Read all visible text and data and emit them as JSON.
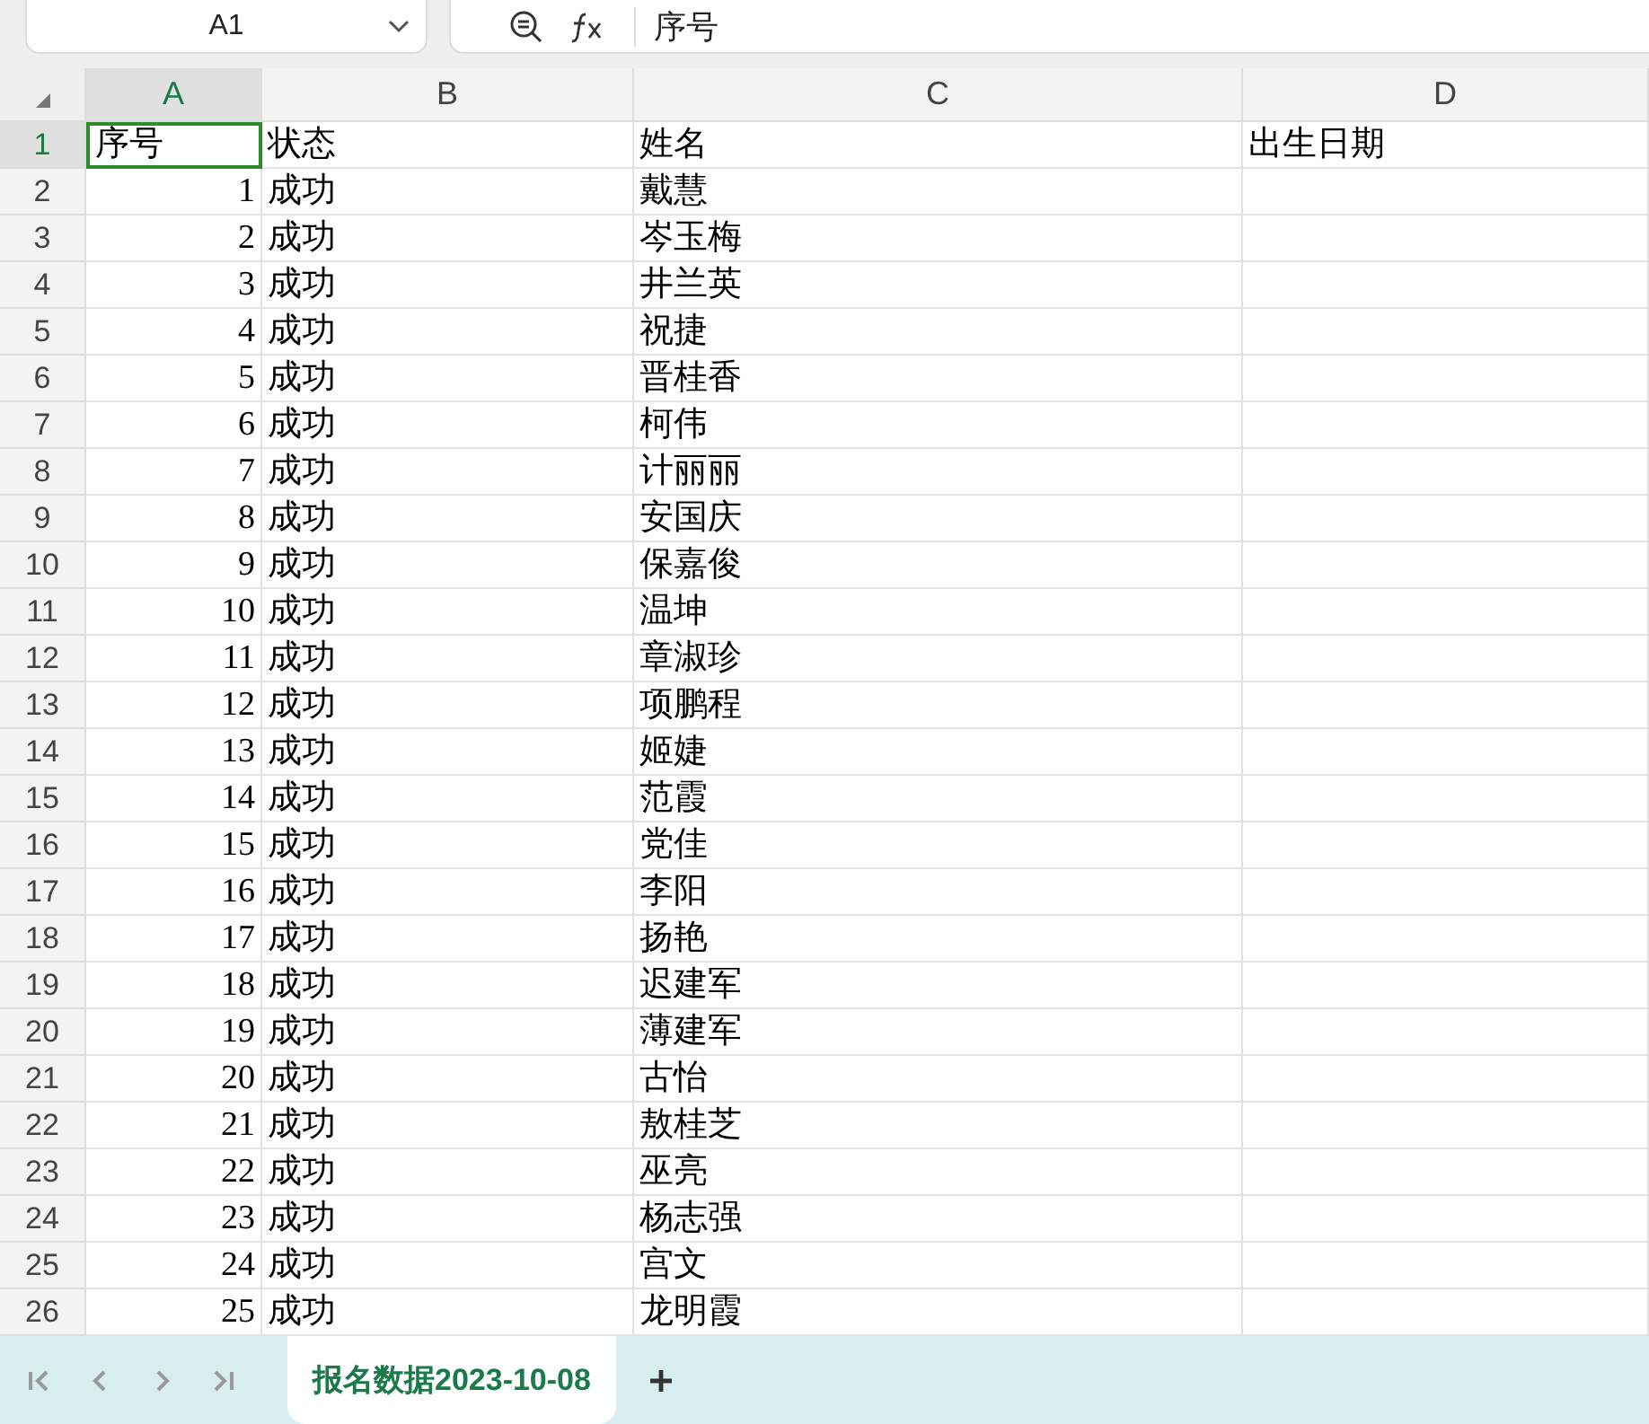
{
  "name_box": {
    "value": "A1"
  },
  "formula_bar": {
    "value": "序号"
  },
  "columns": [
    {
      "label": "A",
      "selected": true
    },
    {
      "label": "B",
      "selected": false
    },
    {
      "label": "C",
      "selected": false
    },
    {
      "label": "D",
      "selected": false
    }
  ],
  "rows": [
    {
      "number": "1",
      "selected": true,
      "cells": [
        {
          "text": "序号",
          "kind": "text"
        },
        {
          "text": "状态",
          "kind": "text"
        },
        {
          "text": "姓名",
          "kind": "text"
        },
        {
          "text": "出生日期",
          "kind": "text"
        }
      ]
    },
    {
      "number": "2",
      "selected": false,
      "cells": [
        {
          "text": "1",
          "kind": "number"
        },
        {
          "text": "成功",
          "kind": "text"
        },
        {
          "text": "戴慧",
          "kind": "text"
        }
      ]
    },
    {
      "number": "3",
      "selected": false,
      "cells": [
        {
          "text": "2",
          "kind": "number"
        },
        {
          "text": "成功",
          "kind": "text"
        },
        {
          "text": "岑玉梅",
          "kind": "text"
        }
      ]
    },
    {
      "number": "4",
      "selected": false,
      "cells": [
        {
          "text": "3",
          "kind": "number"
        },
        {
          "text": "成功",
          "kind": "text"
        },
        {
          "text": "井兰英",
          "kind": "text"
        }
      ]
    },
    {
      "number": "5",
      "selected": false,
      "cells": [
        {
          "text": "4",
          "kind": "number"
        },
        {
          "text": "成功",
          "kind": "text"
        },
        {
          "text": "祝捷",
          "kind": "text"
        }
      ]
    },
    {
      "number": "6",
      "selected": false,
      "cells": [
        {
          "text": "5",
          "kind": "number"
        },
        {
          "text": "成功",
          "kind": "text"
        },
        {
          "text": "晋桂香",
          "kind": "text"
        }
      ]
    },
    {
      "number": "7",
      "selected": false,
      "cells": [
        {
          "text": "6",
          "kind": "number"
        },
        {
          "text": "成功",
          "kind": "text"
        },
        {
          "text": "柯伟",
          "kind": "text"
        }
      ]
    },
    {
      "number": "8",
      "selected": false,
      "cells": [
        {
          "text": "7",
          "kind": "number"
        },
        {
          "text": "成功",
          "kind": "text"
        },
        {
          "text": "计丽丽",
          "kind": "text"
        }
      ]
    },
    {
      "number": "9",
      "selected": false,
      "cells": [
        {
          "text": "8",
          "kind": "number"
        },
        {
          "text": "成功",
          "kind": "text"
        },
        {
          "text": "安国庆",
          "kind": "text"
        }
      ]
    },
    {
      "number": "10",
      "selected": false,
      "cells": [
        {
          "text": "9",
          "kind": "number"
        },
        {
          "text": "成功",
          "kind": "text"
        },
        {
          "text": "保嘉俊",
          "kind": "text"
        }
      ]
    },
    {
      "number": "11",
      "selected": false,
      "cells": [
        {
          "text": "10",
          "kind": "number"
        },
        {
          "text": "成功",
          "kind": "text"
        },
        {
          "text": "温坤",
          "kind": "text"
        }
      ]
    },
    {
      "number": "12",
      "selected": false,
      "cells": [
        {
          "text": "11",
          "kind": "number"
        },
        {
          "text": "成功",
          "kind": "text"
        },
        {
          "text": "章淑珍",
          "kind": "text"
        }
      ]
    },
    {
      "number": "13",
      "selected": false,
      "cells": [
        {
          "text": "12",
          "kind": "number"
        },
        {
          "text": "成功",
          "kind": "text"
        },
        {
          "text": "项鹏程",
          "kind": "text"
        }
      ]
    },
    {
      "number": "14",
      "selected": false,
      "cells": [
        {
          "text": "13",
          "kind": "number"
        },
        {
          "text": "成功",
          "kind": "text"
        },
        {
          "text": "姬婕",
          "kind": "text"
        }
      ]
    },
    {
      "number": "15",
      "selected": false,
      "cells": [
        {
          "text": "14",
          "kind": "number"
        },
        {
          "text": "成功",
          "kind": "text"
        },
        {
          "text": "范霞",
          "kind": "text"
        }
      ]
    },
    {
      "number": "16",
      "selected": false,
      "cells": [
        {
          "text": "15",
          "kind": "number"
        },
        {
          "text": "成功",
          "kind": "text"
        },
        {
          "text": "党佳",
          "kind": "text"
        }
      ]
    },
    {
      "number": "17",
      "selected": false,
      "cells": [
        {
          "text": "16",
          "kind": "number"
        },
        {
          "text": "成功",
          "kind": "text"
        },
        {
          "text": "李阳",
          "kind": "text"
        }
      ]
    },
    {
      "number": "18",
      "selected": false,
      "cells": [
        {
          "text": "17",
          "kind": "number"
        },
        {
          "text": "成功",
          "kind": "text"
        },
        {
          "text": "扬艳",
          "kind": "text"
        }
      ]
    },
    {
      "number": "19",
      "selected": false,
      "cells": [
        {
          "text": "18",
          "kind": "number"
        },
        {
          "text": "成功",
          "kind": "text"
        },
        {
          "text": "迟建军",
          "kind": "text"
        }
      ]
    },
    {
      "number": "20",
      "selected": false,
      "cells": [
        {
          "text": "19",
          "kind": "number"
        },
        {
          "text": "成功",
          "kind": "text"
        },
        {
          "text": "薄建军",
          "kind": "text"
        }
      ]
    },
    {
      "number": "21",
      "selected": false,
      "cells": [
        {
          "text": "20",
          "kind": "number"
        },
        {
          "text": "成功",
          "kind": "text"
        },
        {
          "text": "古怡",
          "kind": "text"
        }
      ]
    },
    {
      "number": "22",
      "selected": false,
      "cells": [
        {
          "text": "21",
          "kind": "number"
        },
        {
          "text": "成功",
          "kind": "text"
        },
        {
          "text": "敖桂芝",
          "kind": "text"
        }
      ]
    },
    {
      "number": "23",
      "selected": false,
      "cells": [
        {
          "text": "22",
          "kind": "number"
        },
        {
          "text": "成功",
          "kind": "text"
        },
        {
          "text": "巫亮",
          "kind": "text"
        }
      ]
    },
    {
      "number": "24",
      "selected": false,
      "cells": [
        {
          "text": "23",
          "kind": "number"
        },
        {
          "text": "成功",
          "kind": "text"
        },
        {
          "text": "杨志强",
          "kind": "text"
        }
      ]
    },
    {
      "number": "25",
      "selected": false,
      "cells": [
        {
          "text": "24",
          "kind": "number"
        },
        {
          "text": "成功",
          "kind": "text"
        },
        {
          "text": "宫文",
          "kind": "text"
        }
      ]
    },
    {
      "number": "26",
      "selected": false,
      "cells": [
        {
          "text": "25",
          "kind": "number"
        },
        {
          "text": "成功",
          "kind": "text"
        },
        {
          "text": "龙明霞",
          "kind": "text"
        }
      ]
    }
  ],
  "sheet_tabs": [
    {
      "label": "报名数据2023-10-08",
      "selected": true
    }
  ]
}
